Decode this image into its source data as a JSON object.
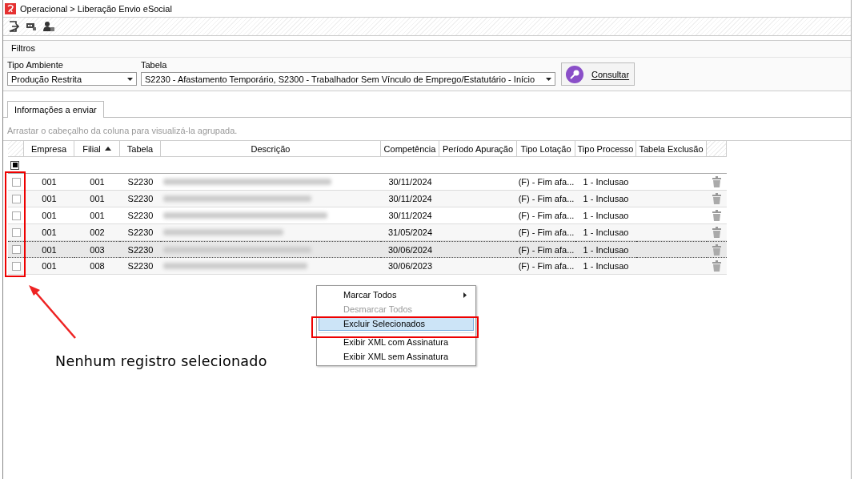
{
  "window": {
    "title": "Operacional > Liberação Envio eSocial"
  },
  "filters": {
    "title": "Filtros",
    "tipo_ambiente": {
      "label": "Tipo Ambiente",
      "value": "Produção Restrita"
    },
    "tabela": {
      "label": "Tabela",
      "value": "S2230 - Afastamento Temporário, S2300 - Trabalhador Sem Vínculo de Emprego/Estatutário - Início"
    },
    "button": "Consultar"
  },
  "tabs": [
    {
      "label": "Informações a enviar",
      "selected": true
    }
  ],
  "group_hint": "Arrastar o cabeçalho da coluna para visualizá-la agrupada.",
  "table": {
    "columns": [
      {
        "label": "Empresa",
        "sorted": false
      },
      {
        "label": "Filial",
        "sorted": true
      },
      {
        "label": "Tabela",
        "sorted": false
      },
      {
        "label": "Descrição",
        "sorted": false
      },
      {
        "label": "Competência",
        "sorted": false
      },
      {
        "label": "Período Apuração",
        "sorted": false
      },
      {
        "label": "Tipo Lotação",
        "sorted": false
      },
      {
        "label": "Tipo Processo",
        "sorted": false
      },
      {
        "label": "Tabela Exclusão",
        "sorted": false
      }
    ],
    "select_all": {
      "checked": true
    },
    "rows": [
      {
        "empresa": "001",
        "filial": "001",
        "tabela": "S2230",
        "competencia": "30/11/2024",
        "tipo_lotacao": "(F) - Fim afa...",
        "tipo_processo": "1 - Inclusao",
        "checked": false,
        "selected": false
      },
      {
        "empresa": "001",
        "filial": "001",
        "tabela": "S2230",
        "competencia": "30/11/2024",
        "tipo_lotacao": "(F) - Fim afa...",
        "tipo_processo": "1 - Inclusao",
        "checked": false,
        "selected": false
      },
      {
        "empresa": "001",
        "filial": "001",
        "tabela": "S2230",
        "competencia": "30/11/2024",
        "tipo_lotacao": "(F) - Fim afa...",
        "tipo_processo": "1 - Inclusao",
        "checked": false,
        "selected": false
      },
      {
        "empresa": "001",
        "filial": "002",
        "tabela": "S2230",
        "competencia": "31/05/2024",
        "tipo_lotacao": "(F) - Fim afa...",
        "tipo_processo": "1 - Inclusao",
        "checked": false,
        "selected": false
      },
      {
        "empresa": "001",
        "filial": "003",
        "tabela": "S2230",
        "competencia": "30/06/2024",
        "tipo_lotacao": "(F) - Fim afa...",
        "tipo_processo": "1 - Inclusao",
        "checked": false,
        "selected": true
      },
      {
        "empresa": "001",
        "filial": "008",
        "tabela": "S2230",
        "competencia": "30/06/2023",
        "tipo_lotacao": "(F) - Fim afa...",
        "tipo_processo": "1 - Inclusao",
        "checked": false,
        "selected": false
      }
    ]
  },
  "context_menu": [
    {
      "label": "Marcar Todos",
      "submenu": true,
      "disabled": false,
      "selected": false
    },
    {
      "label": "Desmarcar Todos",
      "submenu": false,
      "disabled": true,
      "selected": false
    },
    {
      "label": "Excluir Selecionados",
      "submenu": false,
      "disabled": false,
      "selected": true
    },
    {
      "label": "Exibir XML com Assinatura",
      "submenu": false,
      "disabled": false,
      "selected": false
    },
    {
      "label": "Exibir XML sem Assinatura",
      "submenu": false,
      "disabled": false,
      "selected": false
    }
  ],
  "annotation": {
    "text": "Nenhum registro selecionado"
  }
}
